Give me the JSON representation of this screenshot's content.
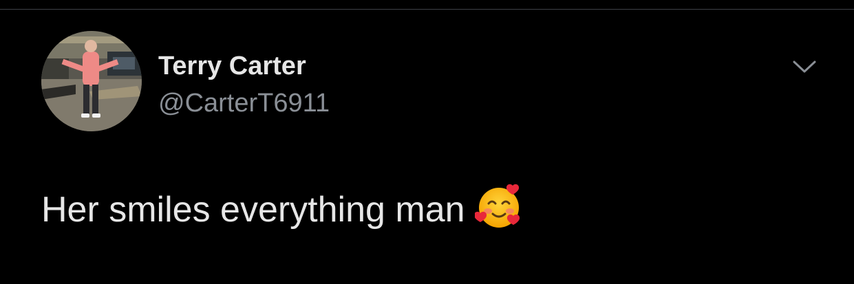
{
  "tweet": {
    "author": {
      "display_name": "Terry Carter",
      "handle": "@CarterT6911",
      "avatar_icon": "profile-photo"
    },
    "text": "Her smiles everything man",
    "emoji": "smiling-face-with-hearts",
    "menu_icon": "chevron-down-icon"
  },
  "colors": {
    "background": "#000000",
    "primary_text": "#e6e6e6",
    "secondary_text": "#8a8f96",
    "divider": "#3d4148"
  }
}
